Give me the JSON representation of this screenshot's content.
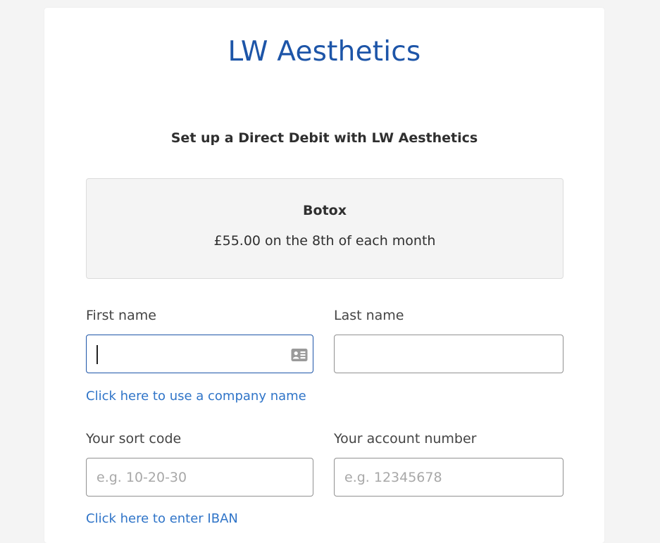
{
  "merchant": {
    "name": "LW Aesthetics"
  },
  "setup": {
    "title": "Set up a Direct Debit with LW Aesthetics"
  },
  "plan": {
    "name": "Botox",
    "amount_text": "£55.00 on the 8th of each month"
  },
  "form": {
    "first_name": {
      "label": "First name",
      "value": "",
      "placeholder": ""
    },
    "last_name": {
      "label": "Last name",
      "value": "",
      "placeholder": ""
    },
    "company_link": "Click here to use a company name",
    "sort_code": {
      "label": "Your sort code",
      "value": "",
      "placeholder": "e.g. 10-20-30"
    },
    "account_number": {
      "label": "Your account number",
      "value": "",
      "placeholder": "e.g. 12345678"
    },
    "iban_link": "Click here to enter IBAN"
  },
  "icons": {
    "first_name_autofill": "contact-card-icon"
  },
  "colors": {
    "brand": "#1d55a8",
    "link": "#2f74c8",
    "page_background": "#f4f4f4",
    "text": "#2f2f2f"
  }
}
